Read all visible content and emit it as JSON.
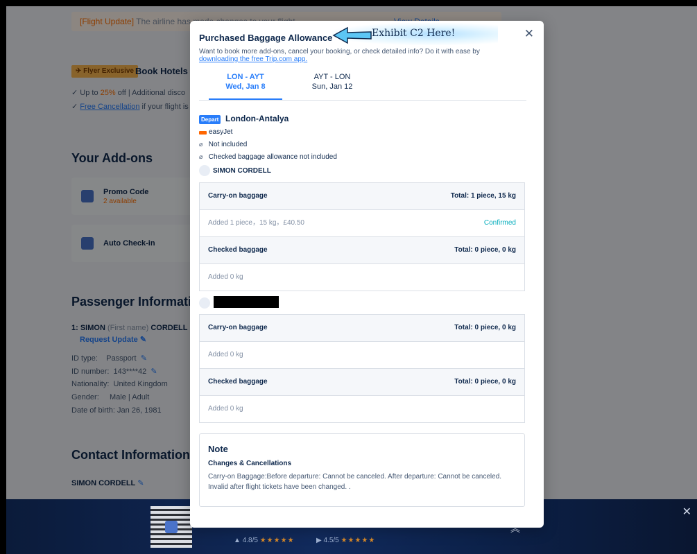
{
  "background": {
    "flight_update_tag": "[Flight Update]",
    "flight_update_text": "The airline has made changes to your flight.",
    "flight_update_link": "View Details",
    "flyer_badge": "✈ Flyer Exclusive",
    "hotel_title": "Book Hotels in",
    "benefit_1_prefix": "Up to ",
    "benefit_1_hl": "25%",
    "benefit_1_rest": " off | Additional disco",
    "benefit_2_link": "Free Cancellation",
    "benefit_2_rest": " if your flight is",
    "addons_title": "Your Add-ons",
    "addon_promo_name": "Promo Code",
    "addon_promo_sub": "2 available",
    "addon_checkin_name": "Auto Check-in",
    "passenger_title": "Passenger Informati",
    "passenger_line_prefix": "1: SIMON",
    "passenger_first": "(First name)",
    "passenger_last": "CORDELL",
    "request_update": "Request Update",
    "id_type_label": "ID type:",
    "id_type_value": "Passport",
    "id_number_label": "ID number:",
    "id_number_value": "143****42",
    "nationality_label": "Nationality:",
    "nationality_value": "United Kingdom",
    "gender_label": "Gender:",
    "gender_value": "Male | Adult",
    "dob_label": "Date of birth:",
    "dob_value": "Jan 26, 1981",
    "contact_title": "Contact Information",
    "contact_name": "SIMON CORDELL"
  },
  "footer": {
    "rating_ios": "4.8/5",
    "rating_android": "4.5/5",
    "stars": "★★★★★",
    "close": "✕",
    "chevron": "︽"
  },
  "modal": {
    "title": "Purchased Baggage Allowance",
    "annotation": "Exhibit C2 Here!",
    "close": "✕",
    "desc_prefix": "Want to book more add-ons, cancel your booking, or check detailed info? Do it with ease by",
    "desc_link": "downloading the free Trip.com app.",
    "tabs": [
      {
        "route": "LON - AYT",
        "date": "Wed, Jan 8",
        "active": true
      },
      {
        "route": "AYT - LON",
        "date": "Sun, Jan 12",
        "active": false
      }
    ],
    "depart_badge": "Depart",
    "route_name": "London-Antalya",
    "airline": "easyJet",
    "not_included": "Not included",
    "checked_not_included": "Checked baggage allowance not included",
    "passenger_1": "SIMON CORDELL",
    "passenger_1_rows": [
      {
        "label": "Carry-on baggage",
        "total": "Total: 1 piece, 15 kg",
        "head": true
      },
      {
        "label": "Added 1 piece，15 kg，£40.50",
        "status": "Confirmed",
        "head": false
      },
      {
        "label": "Checked baggage",
        "total": "Total: 0 piece, 0 kg",
        "head": true
      },
      {
        "label": "Added 0 kg",
        "head": false
      }
    ],
    "passenger_2_rows": [
      {
        "label": "Carry-on baggage",
        "total": "Total: 0 piece, 0 kg",
        "head": true
      },
      {
        "label": "Added 0 kg",
        "head": false
      },
      {
        "label": "Checked baggage",
        "total": "Total: 0 piece, 0 kg",
        "head": true
      },
      {
        "label": "Added 0 kg",
        "head": false
      }
    ],
    "note_title": "Note",
    "note_sub": "Changes & Cancellations",
    "note_text": "Carry-on Baggage:Before departure: Cannot be canceled. After departure: Cannot be canceled. Invalid after flight tickets have been changed. ."
  },
  "colors": {
    "primary": "#287dfa",
    "accent_orange": "#ff6f00",
    "confirmed": "#06aebd",
    "text_dark": "#0f294d"
  }
}
